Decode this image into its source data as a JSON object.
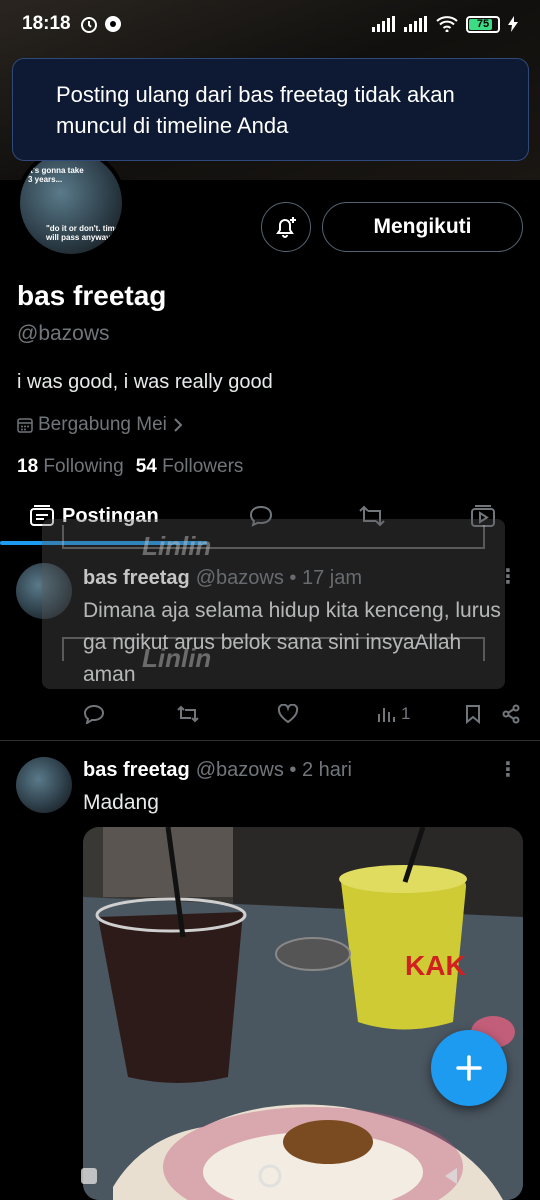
{
  "status_bar": {
    "time": "18:18",
    "battery": "75"
  },
  "toast": {
    "message": "Posting ulang dari bas freetag tidak akan muncul di timeline Anda"
  },
  "profile": {
    "avatar_caption_1": "it's gonna take 3 years...",
    "avatar_caption_2": "\"do it or don't. time will pass anyway\"",
    "follow_label": "Mengikuti",
    "name": "bas freetag",
    "handle": "@bazows",
    "bio": "i was good, i was really good",
    "joined": "Bergabung Mei",
    "following_count": "18",
    "following_label": "Following",
    "followers_count": "54",
    "followers_label": "Followers"
  },
  "tabs": {
    "active_label": "Postingan"
  },
  "watermark": {
    "text": "Linlin"
  },
  "posts": [
    {
      "name": "bas freetag",
      "meta": "@bazows • 17 jam",
      "text": "Dimana aja selama hidup kita kenceng, lurus ga ngikut arus belok sana sini insyaAllah aman",
      "views": "1"
    },
    {
      "name": "bas freetag",
      "meta": "@bazows • 2 hari",
      "text": "Madang",
      "image_sign_text": "KAK"
    }
  ],
  "colors": {
    "accent": "#1d9bf0",
    "muted": "#71767b",
    "divider": "#2f3336"
  },
  "icons": [
    "alarm-icon",
    "signal-icon",
    "wifi-icon",
    "battery-icon",
    "bell-plus-icon",
    "calendar-icon",
    "chevron-right-icon",
    "posts-icon",
    "reply-icon",
    "repost-icon",
    "media-icon",
    "like-icon",
    "views-icon",
    "bookmark-icon",
    "share-icon",
    "more-icon",
    "compose-icon"
  ]
}
